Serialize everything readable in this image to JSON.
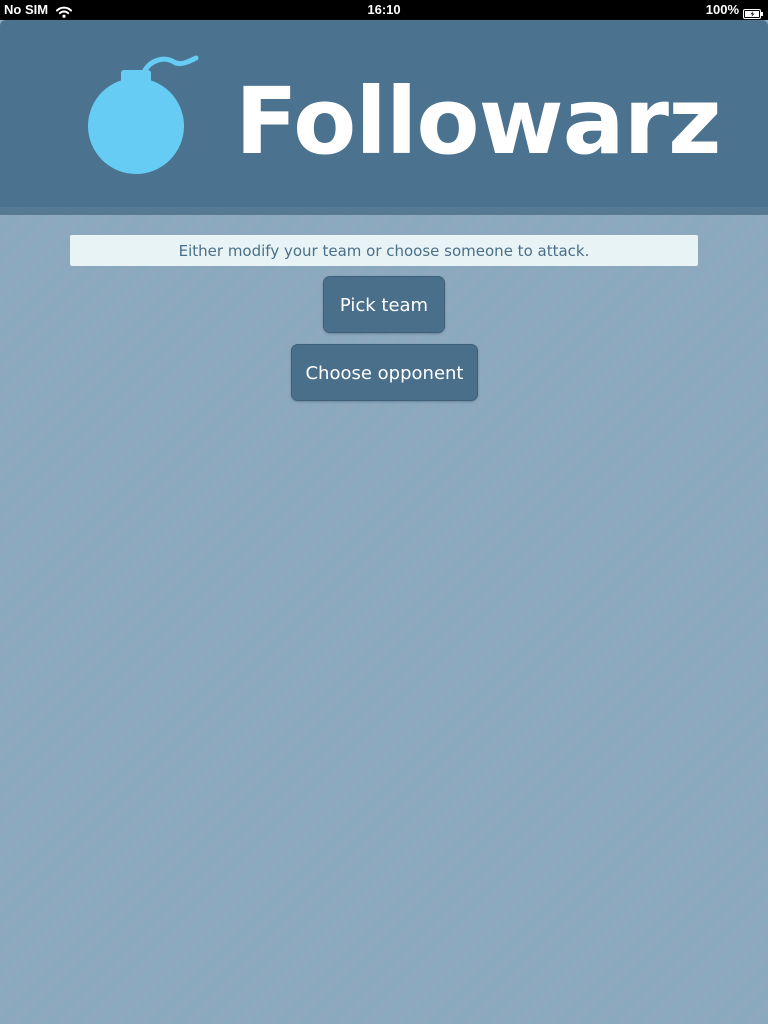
{
  "status_bar": {
    "carrier": "No SIM",
    "time": "16:10",
    "battery": "100%"
  },
  "header": {
    "logo_text": "Followarz",
    "logo_icon": "bomb-icon"
  },
  "main": {
    "instruction": "Either modify your team or choose someone to attack.",
    "pick_team_label": "Pick team",
    "choose_opponent_label": "Choose opponent"
  },
  "colors": {
    "header_bg": "#4b728e",
    "background": "#8aa8be",
    "bomb": "#66ccf3",
    "button_bg": "#4a6f8a",
    "instruction_bg": "#e8f3f6"
  }
}
